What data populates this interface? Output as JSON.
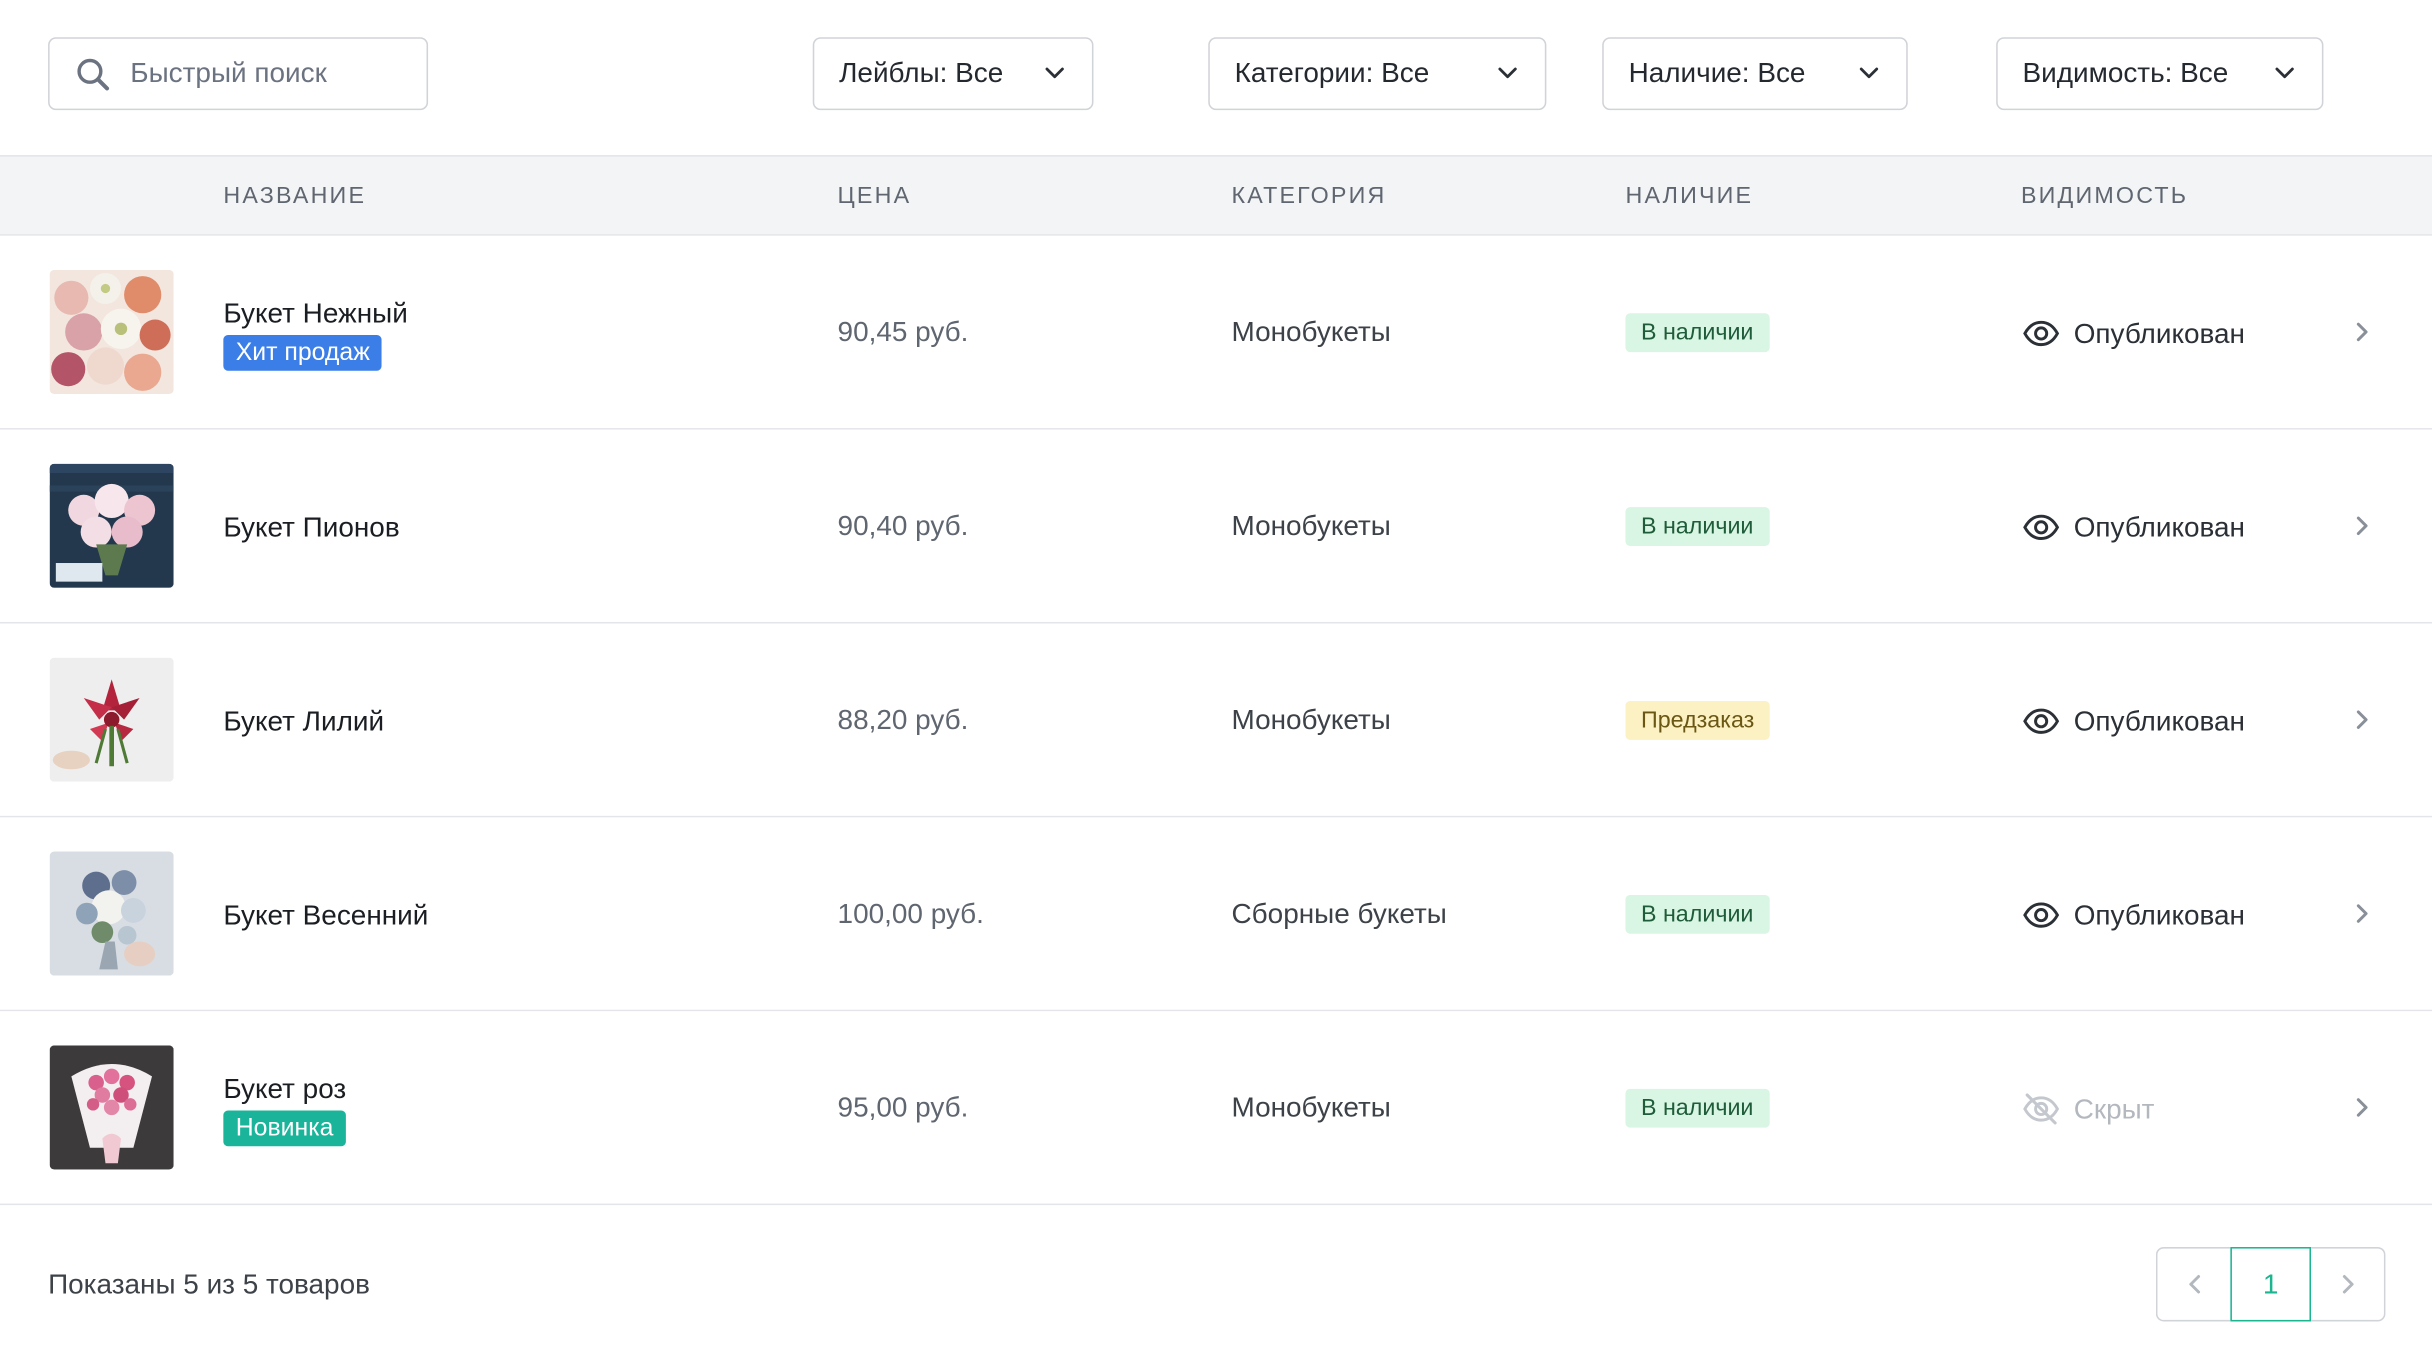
{
  "search": {
    "placeholder": "Быстрый поиск",
    "icon": "search-icon"
  },
  "filters": {
    "labels": "Лейблы: Все",
    "categories": "Категории: Все",
    "stock": "Наличие: Все",
    "visibility": "Видимость: Все"
  },
  "table": {
    "headers": {
      "name": "НАЗВАНИЕ",
      "price": "ЦЕНА",
      "category": "КАТЕГОРИЯ",
      "stock": "НАЛИЧИЕ",
      "visibility": "ВИДИМОСТЬ"
    },
    "rows": [
      {
        "name": "Букет Нежный",
        "label": "Хит продаж",
        "label_color": "#3b7ee8",
        "price": "90,45 руб.",
        "category": "Монобукеты",
        "stock": "В наличии",
        "stock_kind": "in",
        "visibility": "Опубликован",
        "visible": true
      },
      {
        "name": "Букет Пионов",
        "label": "",
        "label_color": "",
        "price": "90,40 руб.",
        "category": "Монобукеты",
        "stock": "В наличии",
        "stock_kind": "in",
        "visibility": "Опубликован",
        "visible": true
      },
      {
        "name": "Букет Лилий",
        "label": "",
        "label_color": "",
        "price": "88,20 руб.",
        "category": "Монобукеты",
        "stock": "Предзаказ",
        "stock_kind": "preorder",
        "visibility": "Опубликован",
        "visible": true
      },
      {
        "name": "Букет Весенний",
        "label": "",
        "label_color": "",
        "price": "100,00 руб.",
        "category": "Сборные букеты",
        "stock": "В наличии",
        "stock_kind": "in",
        "visibility": "Опубликован",
        "visible": true
      },
      {
        "name": "Букет роз",
        "label": "Новинка",
        "label_color": "#19b49a",
        "price": "95,00 руб.",
        "category": "Монобукеты",
        "stock": "В наличии",
        "stock_kind": "in",
        "visibility": "Скрыт",
        "visible": false
      }
    ]
  },
  "footer": {
    "summary": "Показаны 5 из 5 товаров"
  },
  "pagination": {
    "current": "1"
  },
  "colors": {
    "accent": "#1bb58f",
    "in_stock_bg": "#d9f5e3",
    "in_stock_text": "#1f5c3a",
    "preorder_bg": "#fbf1c2",
    "preorder_text": "#6a5714",
    "published": "#2b3036",
    "hidden": "#b3b8bf"
  }
}
